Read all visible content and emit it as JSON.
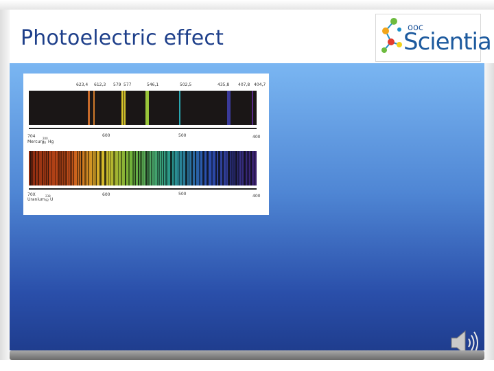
{
  "slide": {
    "title": "Photoelectric effect",
    "logo": {
      "text_top": "ooc",
      "text_main": "Scientia"
    },
    "colors": {
      "title": "#1e3f8a",
      "content_top": "#7ab6f2",
      "content_bottom": "#1f3d8e"
    }
  },
  "figure": {
    "top_labels": [
      "623,4",
      "612,3",
      "579",
      "577",
      "546,1",
      "502,5",
      "435,8",
      "407,8",
      "404,7"
    ],
    "mercury": {
      "code": "704",
      "name": "Mercury",
      "symbol": "Hg",
      "mass": "200",
      "z": "80",
      "ticks": [
        "600",
        "500",
        "400"
      ]
    },
    "uranium": {
      "code": "70X",
      "name": "Uranium",
      "symbol": "U",
      "mass": "238",
      "z": "92",
      "ticks": [
        "600",
        "500",
        "400"
      ]
    }
  }
}
